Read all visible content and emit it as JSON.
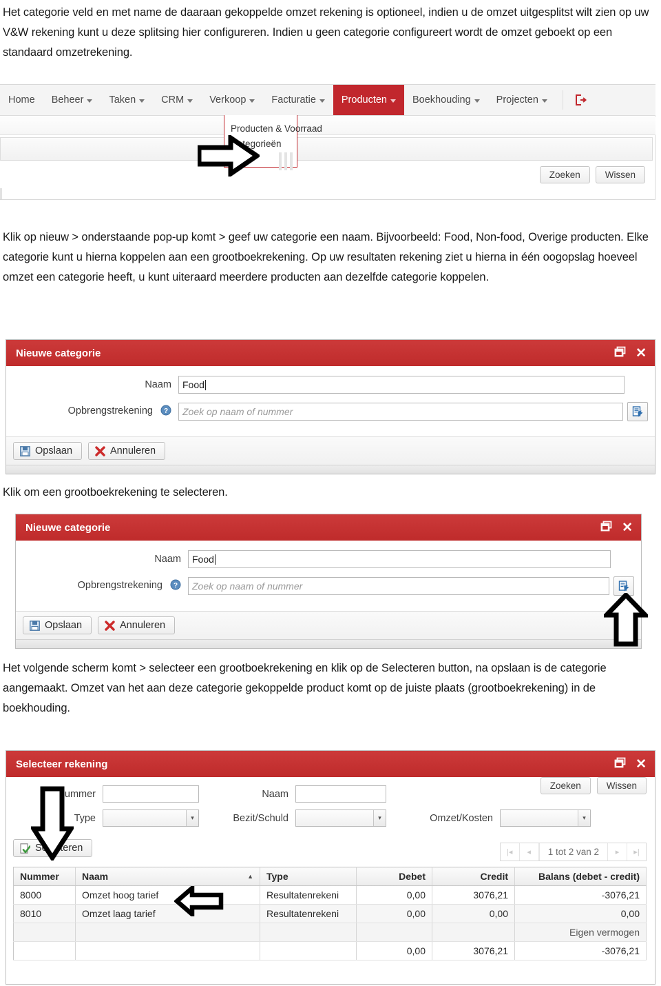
{
  "document": {
    "paragraphs": {
      "intro": "Het categorie veld en met name de daaraan gekoppelde omzet rekening is optioneel, indien u de omzet uitgesplitst wilt zien op uw V&W rekening kunt u deze splitsing hier configureren. Indien u geen categorie configureert wordt de omzet geboekt op een standaard omzetrekening.",
      "nieuw": "Klik op nieuw > onderstaande pop-up komt > geef uw categorie een naam. Bijvoorbeeld: Food, Non-food, Overige producten. Elke categorie kunt u hierna koppelen aan een grootboekrekening. Op uw resultaten rekening ziet u hierna in één oogopslag hoeveel omzet een categorie heeft, u kunt uiteraard meerdere producten aan dezelfde categorie koppelen.",
      "klik_selecteren": "Klik om een grootboekrekening te selecteren.",
      "volgend_scherm": "Het volgende scherm komt > selecteer een grootboekrekening en klik op de Selecteren button, na opslaan is de categorie aangemaakt. Omzet van het aan deze categorie gekoppelde product komt op de juiste plaats (grootboekrekening) in de boekhouding."
    }
  },
  "colors": {
    "brand_red": "#c1272d",
    "dialog_title_red": "#bf2b2b",
    "panel_grey": "#f4f4f4",
    "text": "#1a1a1a"
  },
  "navbar": {
    "items": [
      {
        "label": "Home",
        "has_caret": false,
        "active": false
      },
      {
        "label": "Beheer",
        "has_caret": true,
        "active": false
      },
      {
        "label": "Taken",
        "has_caret": true,
        "active": false
      },
      {
        "label": "CRM",
        "has_caret": true,
        "active": false
      },
      {
        "label": "Verkoop",
        "has_caret": true,
        "active": false
      },
      {
        "label": "Facturatie",
        "has_caret": true,
        "active": false
      },
      {
        "label": "Producten",
        "has_caret": true,
        "active": true
      },
      {
        "label": "Boekhouding",
        "has_caret": true,
        "active": false
      },
      {
        "label": "Projecten",
        "has_caret": true,
        "active": false
      }
    ],
    "logout_icon": "logout-icon",
    "dropdown": {
      "items": [
        {
          "label": "Producten & Voorraad"
        },
        {
          "label": "Categorieën"
        }
      ]
    },
    "buttons": {
      "zoeken": "Zoeken",
      "wissen": "Wissen"
    }
  },
  "dialog_new_category": {
    "title": "Nieuwe categorie",
    "title_icons": {
      "restore": "restore-window-icon",
      "close": "close-icon"
    },
    "fields": {
      "naam_label": "Naam",
      "naam_value": "Food",
      "opbrengstrekening_label": "Opbrengstrekening",
      "opbrengstrekening_placeholder": "Zoek op naam of nummer",
      "help_icon": "help-icon",
      "lookup_icon": "lookup-icon"
    },
    "buttons": {
      "opslaan": "Opslaan",
      "annuleren": "Annuleren",
      "save_icon": "save-icon",
      "cancel_icon": "cancel-icon"
    }
  },
  "dialog_select_account": {
    "title": "Selecteer rekening",
    "title_icons": {
      "restore": "restore-window-icon",
      "close": "close-icon"
    },
    "filters": {
      "nummer_label": "Nummer",
      "nummer_value": "",
      "naam_label": "Naam",
      "naam_value": "",
      "type_label": "Type",
      "type_value": "",
      "bezit_schuld_label": "Bezit/Schuld",
      "bezit_schuld_value": "",
      "omzet_kosten_label": "Omzet/Kosten",
      "omzet_kosten_value": ""
    },
    "buttons": {
      "zoeken": "Zoeken",
      "wissen": "Wissen",
      "selecteren": "Selecteren",
      "select_icon": "select-page-check-icon"
    },
    "pager": {
      "first": "first-page-icon",
      "prev": "prev-page-icon",
      "label": "1 tot 2 van 2",
      "next": "next-page-icon",
      "last": "last-page-icon"
    },
    "grid": {
      "columns": [
        "Nummer",
        "Naam",
        "Type",
        "Debet",
        "Credit",
        "Balans (debet - credit)"
      ],
      "sorted_column": "Naam",
      "sort_direction": "asc",
      "rows": [
        {
          "nummer": "8000",
          "naam": "Omzet hoog tarief",
          "type": "Resultatenrekeni",
          "debet": "0,00",
          "credit": "3076,21",
          "balans": "-3076,21"
        },
        {
          "nummer": "8010",
          "naam": "Omzet laag tarief",
          "type": "Resultatenrekeni",
          "debet": "0,00",
          "credit": "0,00",
          "balans": "0,00"
        }
      ],
      "group_label": "Eigen vermogen",
      "totals": {
        "nummer": "",
        "naam": "",
        "type": "",
        "debet": "0,00",
        "credit": "3076,21",
        "balans": "-3076,21"
      }
    }
  },
  "annotations": {
    "arrow_to_categorieen": "arrow-right-icon",
    "arrow_to_lookup_button": "arrow-up-icon",
    "arrow_to_selecteren_button": "arrow-down-icon",
    "arrow_to_account_row": "arrow-left-icon"
  }
}
